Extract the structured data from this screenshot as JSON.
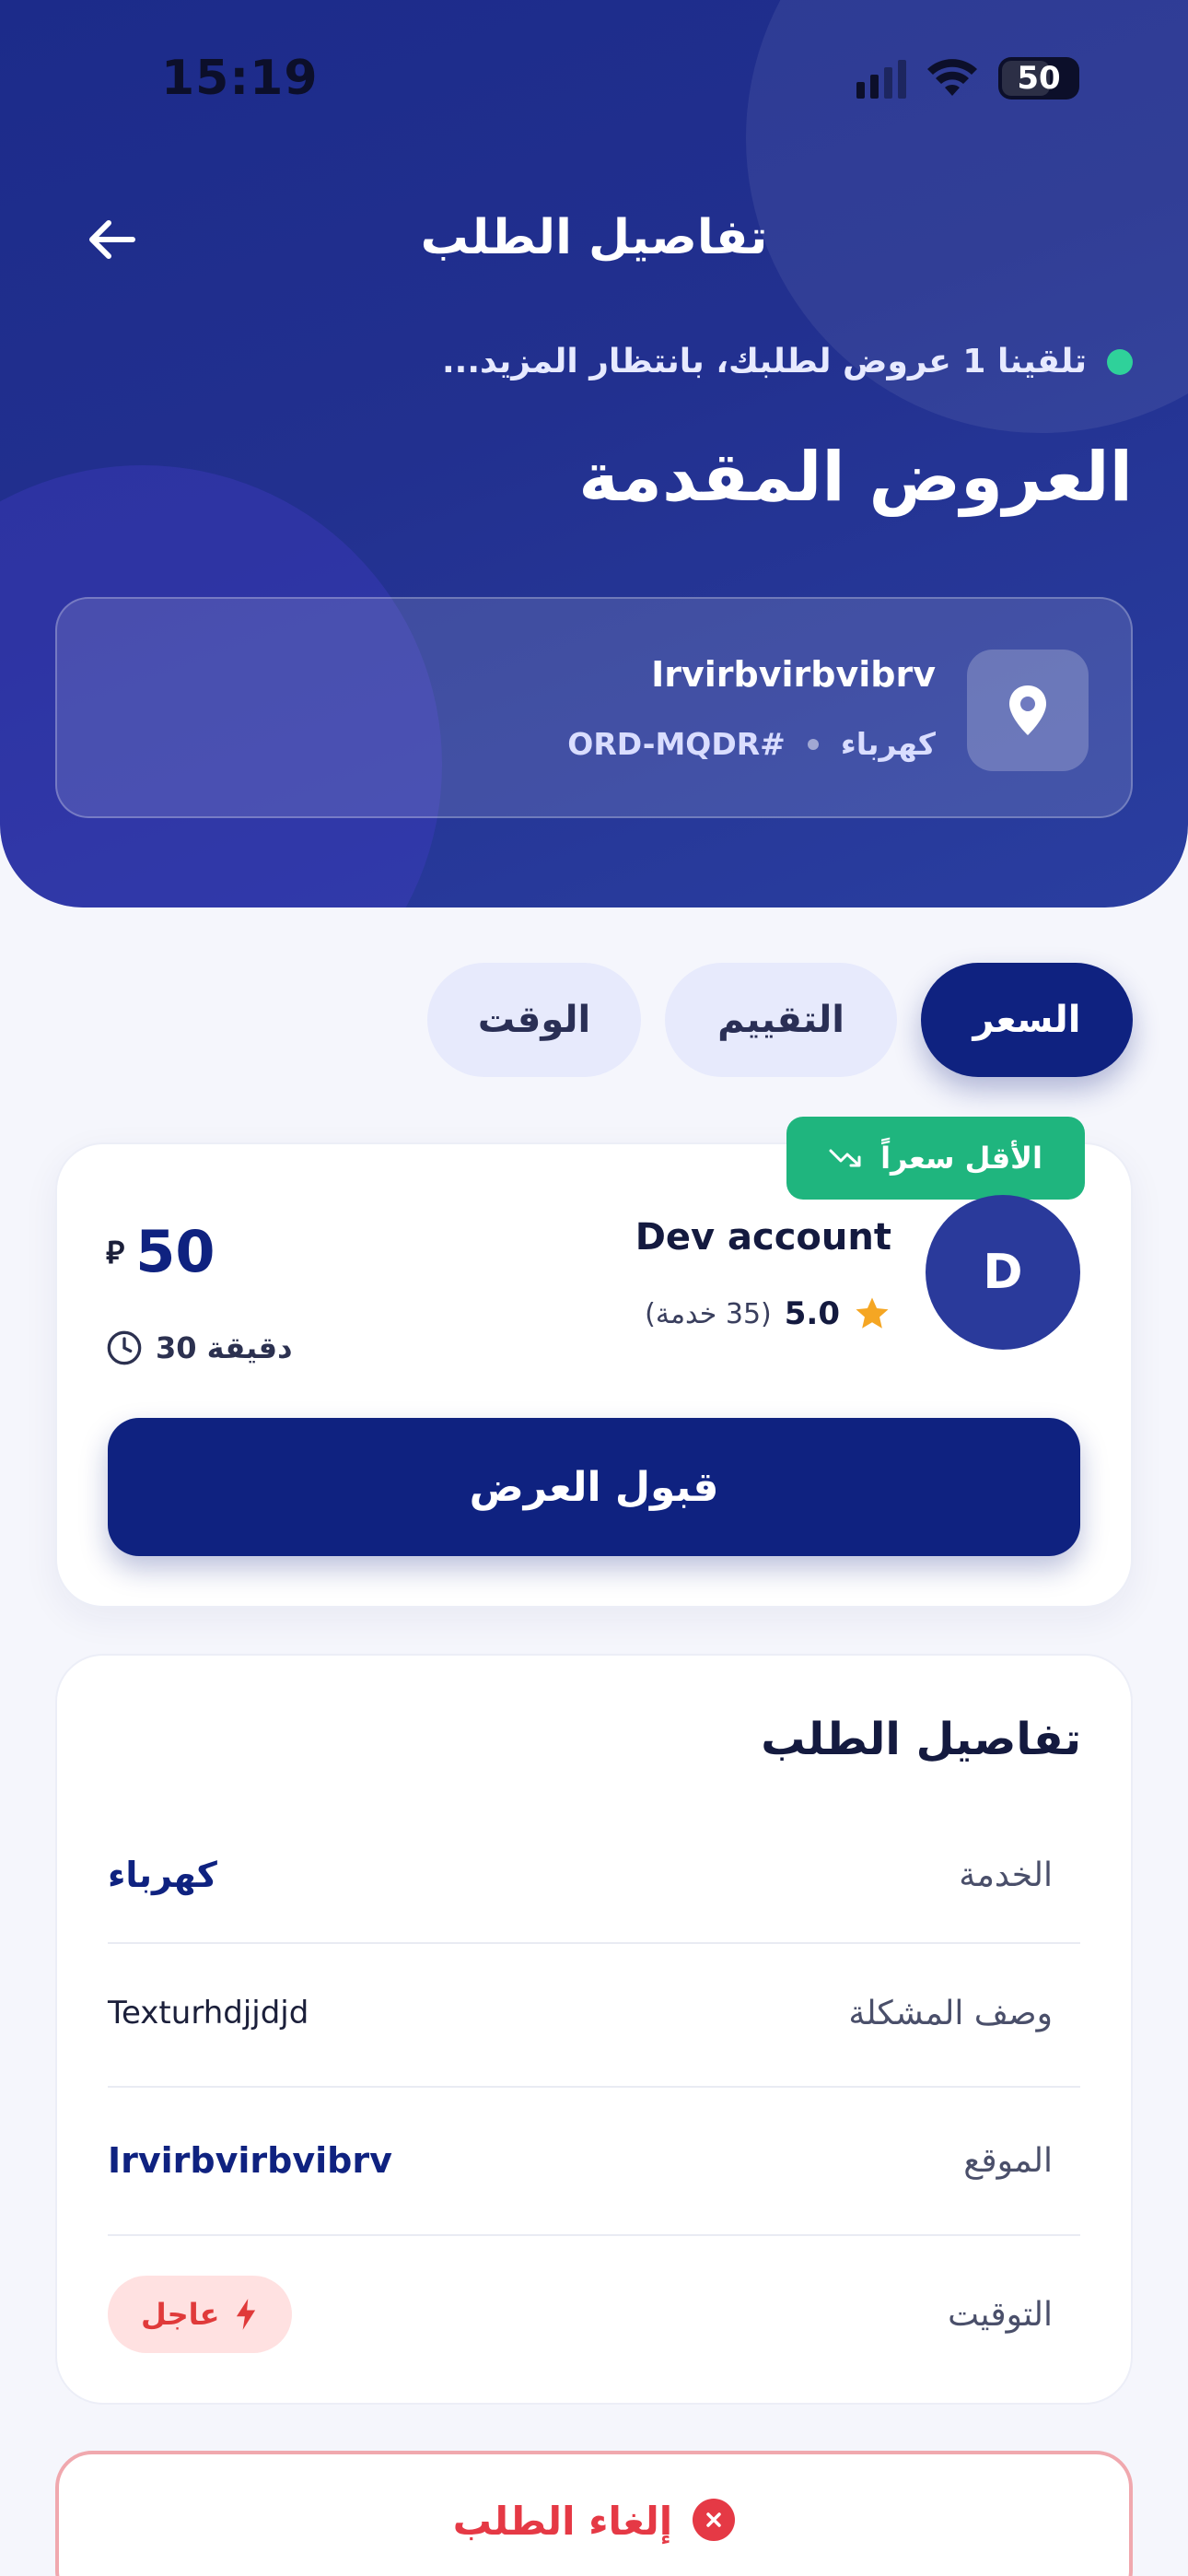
{
  "status_bar": {
    "time": "15:19",
    "battery": "50"
  },
  "header": {
    "title": "تفاصيل الطلب",
    "notice": "تلقينا 1 عروض لطلبك، بانتظار المزيد...",
    "offers_title": "العروض المقدمة"
  },
  "order": {
    "name": "Irvirbvirbvibrv",
    "category": "كهرباء",
    "code": "#ORD-MQDR"
  },
  "filters": [
    {
      "label": "السعر",
      "active": true
    },
    {
      "label": "التقييم",
      "active": false
    },
    {
      "label": "الوقت",
      "active": false
    }
  ],
  "offer": {
    "badge": "الأقل سعراً",
    "avatar_letter": "D",
    "provider_name": "Dev account",
    "rating": "5.0",
    "reviews": "(35 خدمة)",
    "price": "50",
    "currency_symbol": "⃁",
    "duration": "30 دقيقة",
    "accept_label": "قبول العرض"
  },
  "details": {
    "title": "تفاصيل الطلب",
    "rows": [
      {
        "label": "الخدمة",
        "value": "كهرباء"
      },
      {
        "label": "وصف المشكلة",
        "value": "Texturhdjjdjd"
      },
      {
        "label": "الموقع",
        "value": "Irvirbvirbvibrv"
      },
      {
        "label": "التوقيت",
        "value": "عاجل"
      }
    ]
  },
  "cancel_label": "إلغاء الطلب",
  "colors": {
    "primary": "#0f2280",
    "success": "#1fb57e",
    "danger": "#e53945",
    "star": "#f5a623"
  }
}
